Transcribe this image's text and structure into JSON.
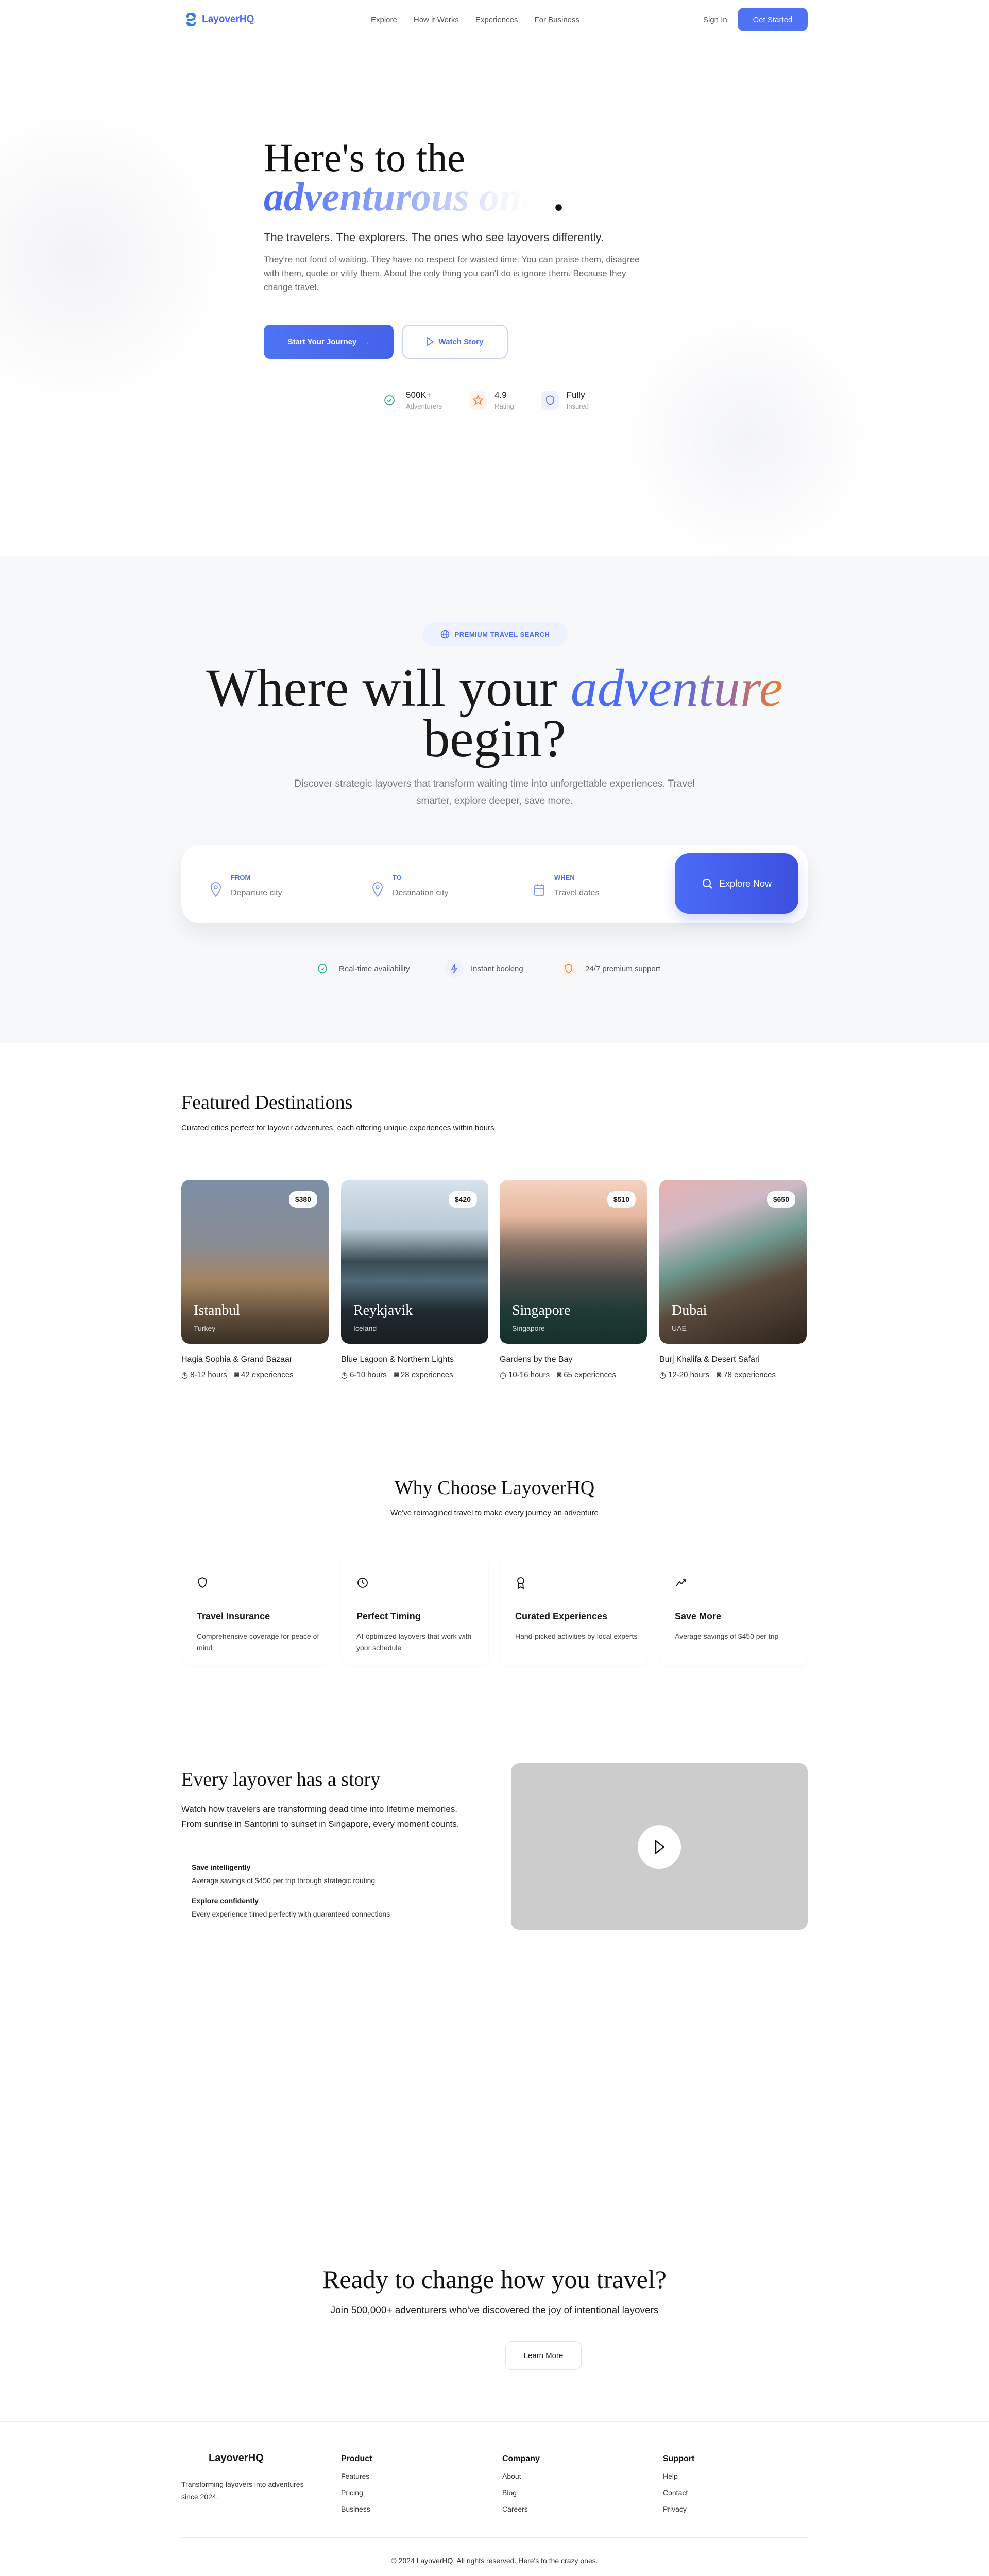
{
  "nav": {
    "brand": "LayoverHQ",
    "links": [
      "Explore",
      "How it Works",
      "Experiences",
      "For Business"
    ],
    "sign_in": "Sign In",
    "get_started": "Get Started"
  },
  "hero": {
    "line1": "Here's to the",
    "line2": "adventurous ones",
    "period": ".",
    "subtitle": "The travelers. The explorers. The ones who see layovers differently.",
    "paragraph": "They're not fond of waiting. They have no respect for wasted time. You can praise them, disagree with them, quote or vilify them. About the only thing you can't do is ignore them. Because they change travel.",
    "cta_primary": "Start Your Journey",
    "cta_secondary": "Watch Story",
    "stats": [
      {
        "value": "500K+",
        "label": "Adventurers",
        "icon": "check-circle-icon"
      },
      {
        "value": "4.9",
        "label": "Rating",
        "icon": "star-icon"
      },
      {
        "value": "Fully",
        "label": "Insured",
        "icon": "shield-icon"
      }
    ]
  },
  "search": {
    "badge": "PREMIUM TRAVEL SEARCH",
    "heading_pre": "Where will your",
    "heading_accent": "adventure",
    "heading_post": "begin?",
    "description": "Discover strategic layovers that transform waiting time into unforgettable experiences. Travel smarter, explore deeper, save more.",
    "fields": [
      {
        "label": "FROM",
        "placeholder": "Departure city"
      },
      {
        "label": "TO",
        "placeholder": "Destination city"
      },
      {
        "label": "WHEN",
        "placeholder": "Travel dates"
      }
    ],
    "button": "Explore Now",
    "features": [
      "Real-time availability",
      "Instant booking",
      "24/7 premium support"
    ]
  },
  "destinations": {
    "title": "Featured Destinations",
    "subtitle": "Curated cities perfect for layover adventures, each offering unique experiences within hours",
    "items": [
      {
        "city": "Istanbul",
        "country": "Turkey",
        "price": "$380",
        "highlight": "Hagia Sophia & Grand Bazaar",
        "hours": "8-12 hours",
        "experiences": "42 experiences"
      },
      {
        "city": "Reykjavik",
        "country": "Iceland",
        "price": "$420",
        "highlight": "Blue Lagoon & Northern Lights",
        "hours": "6-10 hours",
        "experiences": "28 experiences"
      },
      {
        "city": "Singapore",
        "country": "Singapore",
        "price": "$510",
        "highlight": "Gardens by the Bay",
        "hours": "10-16 hours",
        "experiences": "65 experiences"
      },
      {
        "city": "Dubai",
        "country": "UAE",
        "price": "$650",
        "highlight": "Burj Khalifa & Desert Safari",
        "hours": "12-20 hours",
        "experiences": "78 experiences"
      }
    ]
  },
  "why": {
    "title": "Why Choose LayoverHQ",
    "subtitle": "We've reimagined travel to make every journey an adventure",
    "items": [
      {
        "title": "Travel Insurance",
        "desc": "Comprehensive coverage for peace of mind"
      },
      {
        "title": "Perfect Timing",
        "desc": "AI-optimized layovers that work with your schedule"
      },
      {
        "title": "Curated Experiences",
        "desc": "Hand-picked activities by local experts"
      },
      {
        "title": "Save More",
        "desc": "Average savings of $450 per trip"
      }
    ]
  },
  "story": {
    "title": "Every layover has a story",
    "paragraph": "Watch how travelers are transforming dead time into lifetime memories. From sunrise in Santorini to sunset in Singapore, every moment counts.",
    "points": [
      {
        "title": "Save intelligently",
        "desc": "Average savings of $450 per trip through strategic routing"
      },
      {
        "title": "Explore confidently",
        "desc": "Every experience timed perfectly with guaranteed connections"
      }
    ]
  },
  "cta": {
    "title": "Ready to change how you travel?",
    "subtitle": "Join 500,000+ adventurers who've discovered the joy of intentional layovers",
    "button": "Learn More"
  },
  "footer": {
    "brand": "LayoverHQ",
    "tagline": "Transforming layovers into adventures since 2024.",
    "columns": [
      {
        "title": "Product",
        "links": [
          "Features",
          "Pricing",
          "Business"
        ]
      },
      {
        "title": "Company",
        "links": [
          "About",
          "Blog",
          "Careers"
        ]
      },
      {
        "title": "Support",
        "links": [
          "Help",
          "Contact",
          "Privacy"
        ]
      }
    ],
    "copyright": "© 2024 LayoverHQ. All rights reserved. Here's to the crazy ones."
  },
  "colors": {
    "accent": "#4f73f5",
    "orange": "#f47a2a",
    "green": "#22b07d"
  }
}
